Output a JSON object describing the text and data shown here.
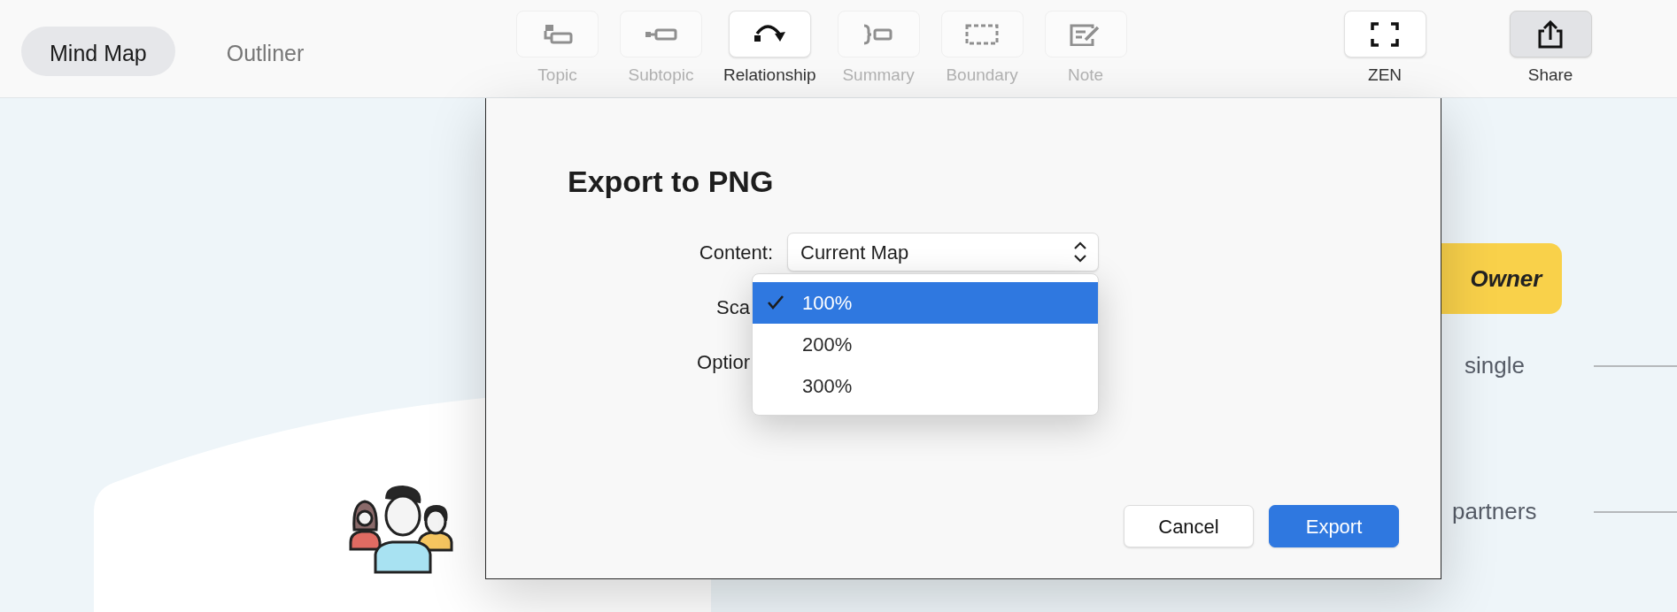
{
  "view_tabs": [
    {
      "label": "Mind Map",
      "selected": true
    },
    {
      "label": "Outliner",
      "selected": false
    }
  ],
  "tools": [
    {
      "label": "Topic",
      "kind": "topic",
      "disabled": true
    },
    {
      "label": "Subtopic",
      "kind": "subtopic",
      "disabled": true
    },
    {
      "label": "Relationship",
      "kind": "relationship",
      "disabled": false
    },
    {
      "label": "Summary",
      "kind": "summary",
      "disabled": true
    },
    {
      "label": "Boundary",
      "kind": "boundary",
      "disabled": true
    },
    {
      "label": "Note",
      "kind": "note",
      "disabled": true
    }
  ],
  "actions": [
    {
      "label": "ZEN",
      "kind": "zen",
      "pressed": false
    },
    {
      "label": "Share",
      "kind": "share",
      "pressed": true
    }
  ],
  "canvas": {
    "nodes": [
      {
        "label": "Owner",
        "kind": "main"
      },
      {
        "label": "single",
        "kind": "branch"
      },
      {
        "label": "partners",
        "kind": "branch"
      }
    ]
  },
  "dialog": {
    "title": "Export to PNG",
    "fields": [
      {
        "label": "Content:",
        "value": "Current Map",
        "covered": false
      },
      {
        "label": "Sca",
        "covered": true
      },
      {
        "label": "Optior",
        "covered": true
      }
    ],
    "scale_menu": [
      {
        "label": "100%",
        "selected": true
      },
      {
        "label": "200%",
        "selected": false
      },
      {
        "label": "300%",
        "selected": false
      }
    ],
    "buttons": [
      {
        "label": "Cancel",
        "kind": "secondary"
      },
      {
        "label": "Export",
        "kind": "primary"
      }
    ]
  }
}
